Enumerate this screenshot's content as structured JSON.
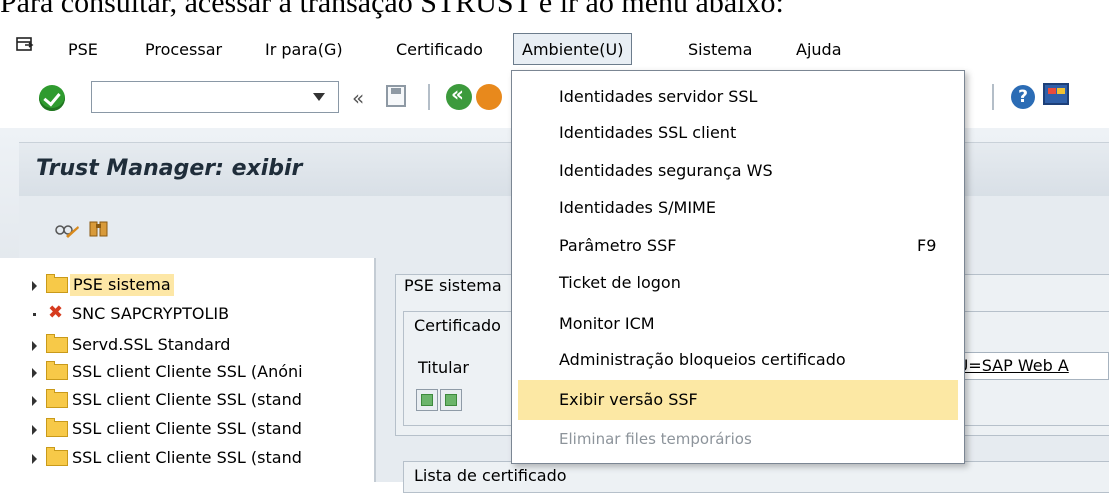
{
  "caption": "Para consultar, acessar a transação STRUST e ir ao menu abaixo:",
  "menubar": {
    "items": [
      "PSE",
      "Processar",
      "Ir para(G)",
      "Certificado",
      "Ambiente(U)",
      "Sistema",
      "Ajuda"
    ],
    "active": "Ambiente(U)"
  },
  "toolbar": {
    "command_value": "",
    "history_glyph": "«",
    "help_glyph": "?"
  },
  "window": {
    "title": "Trust Manager: exibir"
  },
  "tree": {
    "items": [
      {
        "label": "PSE sistema",
        "icon": "folder-icon",
        "selected": true
      },
      {
        "label": "SNC SAPCRYPTOLIB",
        "icon": "error-icon",
        "selected": false
      },
      {
        "label": "Servd.SSL Standard",
        "icon": "folder-icon",
        "selected": false
      },
      {
        "label": "SSL client Cliente SSL (Anóni",
        "icon": "folder-icon",
        "selected": false
      },
      {
        "label": "SSL client Cliente SSL (stand",
        "icon": "folder-icon",
        "selected": false
      },
      {
        "label": "SSL client Cliente SSL (stand",
        "icon": "folder-icon",
        "selected": false
      },
      {
        "label": "SSL client Cliente SSL (stand",
        "icon": "folder-icon",
        "selected": false
      }
    ]
  },
  "detail": {
    "group1_title": "PSE sistema",
    "group2_title": "Certificado",
    "owner_label": "Titular",
    "owner_value": "OU=SAP Web A",
    "list_title": "Lista de certificado"
  },
  "dropdown": {
    "items": [
      {
        "label": "Identidades servidor SSL",
        "shortcut": "",
        "state": "normal"
      },
      {
        "label": "Identidades SSL client",
        "shortcut": "",
        "state": "normal"
      },
      {
        "label": "Identidades segurança WS",
        "shortcut": "",
        "state": "normal"
      },
      {
        "label": "Identidades S/MIME",
        "shortcut": "",
        "state": "normal"
      },
      {
        "label": "Parâmetro SSF",
        "shortcut": "F9",
        "state": "normal"
      },
      {
        "label": "Ticket de logon",
        "shortcut": "",
        "state": "normal"
      },
      {
        "label": "Monitor ICM",
        "shortcut": "",
        "state": "normal"
      },
      {
        "label": "Administração bloqueios certificado",
        "shortcut": "",
        "state": "normal"
      },
      {
        "label": "Exibir versão SSF",
        "shortcut": "",
        "state": "highlighted"
      },
      {
        "label": "Eliminar files temporários",
        "shortcut": "",
        "state": "disabled"
      }
    ]
  },
  "colors": {
    "highlight": "#fce8a4",
    "folder": "#f7c948",
    "ok_green": "#2f9b2f",
    "error_red": "#d63b1e"
  }
}
